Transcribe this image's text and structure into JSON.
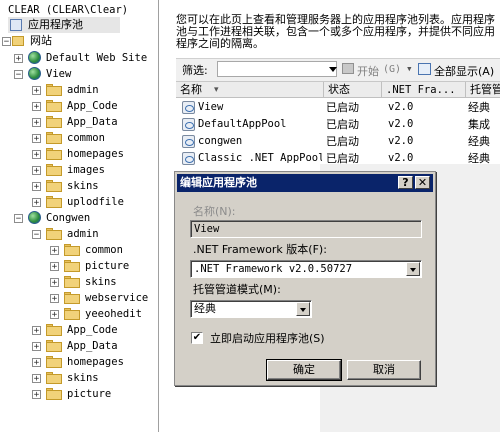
{
  "tree": {
    "root_label": "CLEAR (CLEAR\\Clear)",
    "app_pools_label": "应用程序池",
    "websites_label": "网站",
    "default_site": "Default Web Site",
    "view_site": "View",
    "view_children": [
      "admin",
      "App_Code",
      "App_Data",
      "common",
      "homepages",
      "images",
      "skins",
      "uplodfile"
    ],
    "congwen_site": "Congwen",
    "congwen_admin": "admin",
    "congwen_admin_children": [
      "common",
      "picture",
      "skins",
      "webservice",
      "yeeohedit"
    ],
    "congwen_children": [
      "App_Code",
      "App_Data",
      "homepages",
      "skins",
      "picture"
    ]
  },
  "description": "您可以在此页上查看和管理服务器上的应用程序池列表。应用程序池与工作进程相关联，包含一个或多个应用程序，并提供不同应用程序之间的隔离。",
  "filter": {
    "label": "筛选:",
    "start_label": "开始",
    "start_key": "(G)",
    "show_all_label": "全部显示(A)"
  },
  "table": {
    "headers": [
      "名称",
      "状态",
      ".NET Fra...",
      "托管管"
    ],
    "rows": [
      {
        "name": "View",
        "status": "已启动",
        "fw": "v2.0",
        "mode": "经典"
      },
      {
        "name": "DefaultAppPool",
        "status": "已启动",
        "fw": "v2.0",
        "mode": "集成"
      },
      {
        "name": "congwen",
        "status": "已启动",
        "fw": "v2.0",
        "mode": "经典"
      },
      {
        "name": "Classic .NET AppPool",
        "status": "已启动",
        "fw": "v2.0",
        "mode": "经典"
      }
    ]
  },
  "dialog": {
    "title": "编辑应用程序池",
    "help_glyph": "?",
    "close_glyph": "✕",
    "name_label": "名称(N):",
    "name_value": "View",
    "framework_label": ".NET Framework 版本(F):",
    "framework_value": ".NET Framework v2.0.50727",
    "pipeline_label": "托管管道模式(M):",
    "pipeline_value": "经典",
    "autostart_label": "立即启动应用程序池(S)",
    "autostart_checked": "✔",
    "ok_label": "确定",
    "cancel_label": "取消"
  }
}
